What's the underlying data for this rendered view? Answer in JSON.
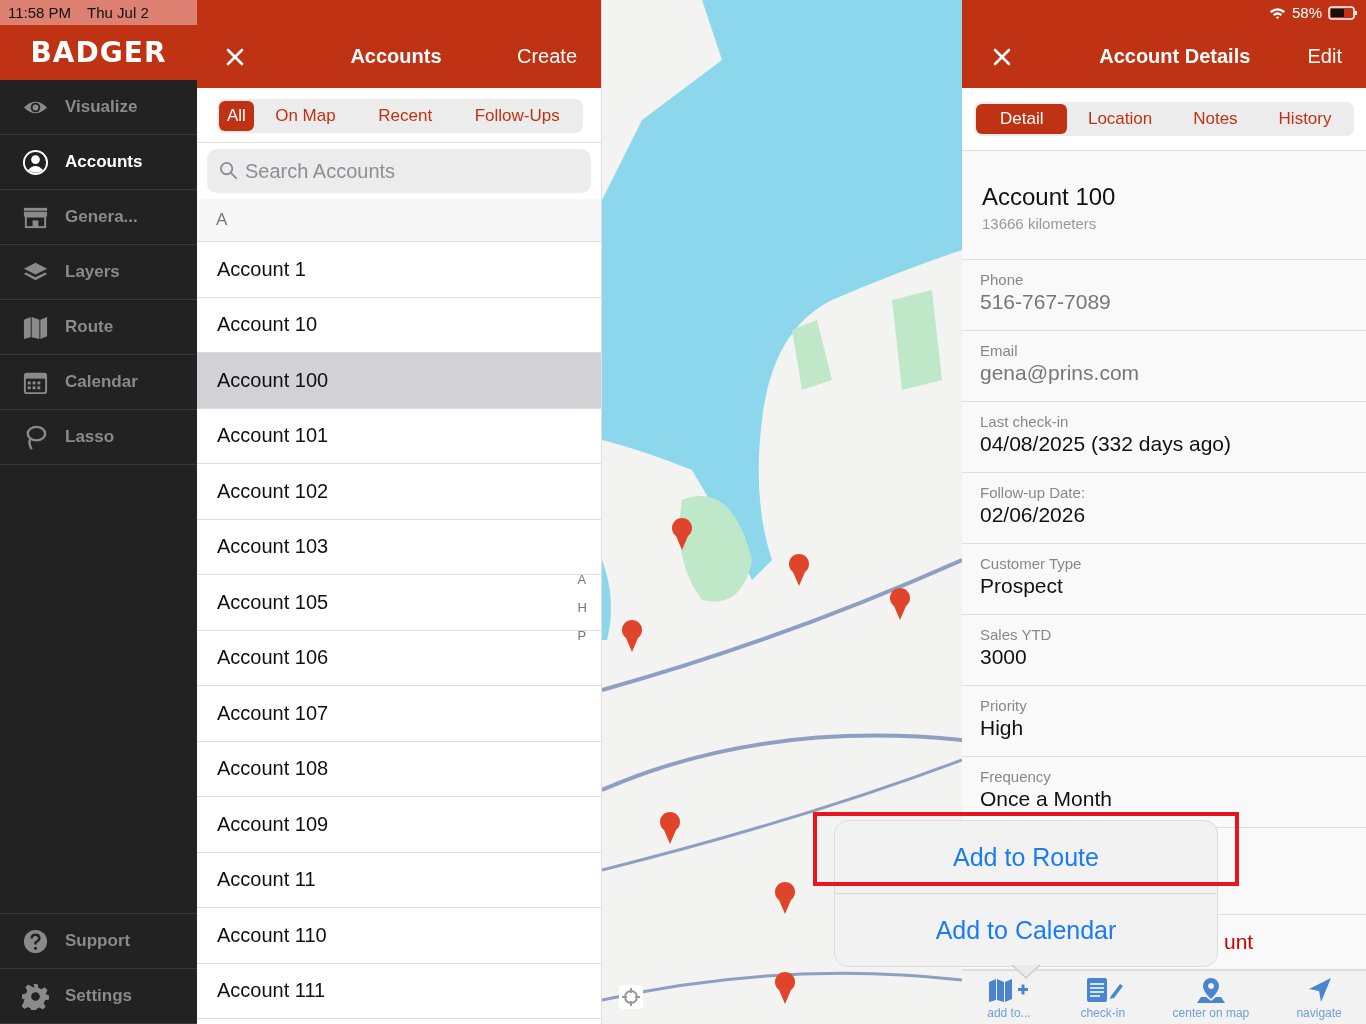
{
  "status_bar": {
    "time": "11:58 PM",
    "date": "Thu Jul 2",
    "battery": "58%"
  },
  "sidebar": {
    "logo": "BADGER",
    "items": [
      {
        "label": "Visualize",
        "selected": false
      },
      {
        "label": "Accounts",
        "selected": true
      },
      {
        "label": "Genera...",
        "selected": false
      },
      {
        "label": "Layers",
        "selected": false
      },
      {
        "label": "Route",
        "selected": false
      },
      {
        "label": "Calendar",
        "selected": false
      },
      {
        "label": "Lasso",
        "selected": false
      }
    ],
    "footer_items": [
      {
        "label": "Support"
      },
      {
        "label": "Settings"
      }
    ]
  },
  "accounts_panel": {
    "title": "Accounts",
    "action": "Create",
    "filters": [
      {
        "label": "All",
        "selected": true
      },
      {
        "label": "On Map",
        "selected": false
      },
      {
        "label": "Recent",
        "selected": false
      },
      {
        "label": "Follow-Ups",
        "selected": false
      }
    ],
    "search": {
      "placeholder": "Search Accounts"
    },
    "section": "A",
    "rows": [
      {
        "name": "Account 1",
        "selected": false
      },
      {
        "name": "Account 10",
        "selected": false
      },
      {
        "name": "Account 100",
        "selected": true
      },
      {
        "name": "Account 101",
        "selected": false
      },
      {
        "name": "Account 102",
        "selected": false
      },
      {
        "name": "Account 103",
        "selected": false
      },
      {
        "name": "Account 105",
        "selected": false
      },
      {
        "name": "Account 106",
        "selected": false
      },
      {
        "name": "Account 107",
        "selected": false
      },
      {
        "name": "Account 108",
        "selected": false
      },
      {
        "name": "Account 109",
        "selected": false
      },
      {
        "name": "Account 11",
        "selected": false
      },
      {
        "name": "Account 110",
        "selected": false
      },
      {
        "name": "Account 111",
        "selected": false
      }
    ],
    "index": [
      "A",
      "H",
      "P"
    ]
  },
  "details": {
    "title": "Account Details",
    "action": "Edit",
    "tabs": [
      {
        "label": "Detail",
        "selected": true
      },
      {
        "label": "Location",
        "selected": false
      },
      {
        "label": "Notes",
        "selected": false
      },
      {
        "label": "History",
        "selected": false
      }
    ],
    "name": "Account 100",
    "distance": "13666 kilometers",
    "fields": [
      {
        "label": "Phone",
        "value": "516-767-7089",
        "kind": "contact"
      },
      {
        "label": "Email",
        "value": "gena@prins.com",
        "kind": "contact"
      },
      {
        "label": "Last check-in",
        "value": "04/08/2025 (332 days ago)",
        "kind": "text"
      },
      {
        "label": "Follow-up Date:",
        "value": "02/06/2026",
        "kind": "text"
      },
      {
        "label": "Customer Type",
        "value": "Prospect",
        "kind": "text"
      },
      {
        "label": "Sales YTD",
        "value": "3000",
        "kind": "text"
      },
      {
        "label": "Priority",
        "value": "High",
        "kind": "text"
      },
      {
        "label": "Frequency",
        "value": "Once a Month",
        "kind": "text"
      }
    ],
    "danger_action": "unt",
    "toolbar": [
      {
        "label": "add to..."
      },
      {
        "label": "check-in"
      },
      {
        "label": "center on map"
      },
      {
        "label": "navigate"
      }
    ]
  },
  "popover": {
    "items": [
      {
        "label": "Add to Route",
        "highlighted": true
      },
      {
        "label": "Add to Calendar",
        "highlighted": false
      }
    ]
  }
}
